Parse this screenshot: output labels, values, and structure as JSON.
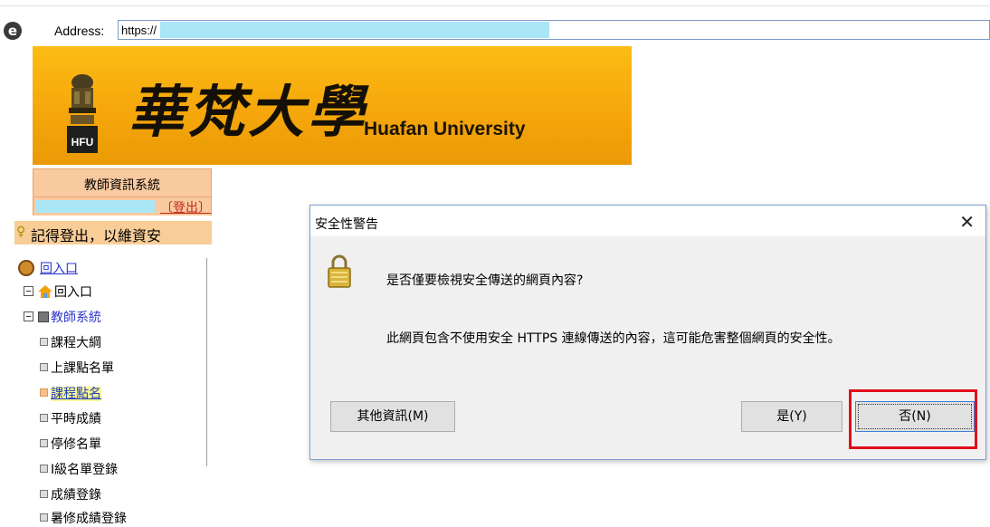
{
  "address_bar": {
    "label": "Address:",
    "url": "https://"
  },
  "banner": {
    "title_cn": "華梵大學",
    "title_en": "Huafan University",
    "emblem_text": "HFU"
  },
  "sidebar": {
    "system_title": "教師資訊系統",
    "logout_label": "〔登出〕",
    "reminder": "記得登出，以維資安"
  },
  "tree": {
    "root_link": "回入口",
    "items": [
      {
        "label": "回入口"
      },
      {
        "label": "教師系統"
      },
      {
        "label": "課程大綱"
      },
      {
        "label": "上課點名單"
      },
      {
        "label": "課程點名"
      },
      {
        "label": "平時成績"
      },
      {
        "label": "停修名單"
      },
      {
        "label": "I級名單登錄"
      },
      {
        "label": "成績登錄"
      },
      {
        "label": "暑修成績登錄"
      }
    ]
  },
  "dialog": {
    "title": "安全性警告",
    "close_glyph": "✕",
    "question": "是否僅要檢視安全傳送的網頁內容?",
    "message": "此網頁包含不使用安全 HTTPS 連線傳送的內容，這可能危害整個網頁的安全性。",
    "buttons": {
      "more_info": "其他資訊(M)",
      "yes": "是(Y)",
      "no": "否(N)"
    }
  },
  "colors": {
    "banner": "#f5a70c",
    "sidebar_box": "#f9c99f",
    "redacted": "#a9e6f6",
    "highlight_box": "#e0101a",
    "link": "#2a35c9"
  }
}
